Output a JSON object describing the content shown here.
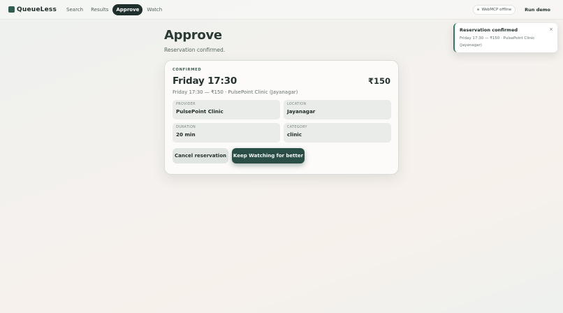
{
  "brand": {
    "name": "QueueLess"
  },
  "nav": {
    "items": [
      {
        "label": "Search",
        "active": false
      },
      {
        "label": "Results",
        "active": false
      },
      {
        "label": "Approve",
        "active": true
      },
      {
        "label": "Watch",
        "active": false
      }
    ]
  },
  "header": {
    "status_label": "WebMCP offline",
    "run_demo_label": "Run demo"
  },
  "page": {
    "title": "Approve",
    "subtitle": "Reservation confirmed."
  },
  "card": {
    "kicker": "CONFIRMED",
    "title": "Friday 17:30",
    "price": "₹150",
    "summary": "Friday 17:30 — ₹150 · PulsePoint Clinic (Jayanagar)",
    "fields": [
      {
        "label": "PROVIDER",
        "value": "PulsePoint Clinic"
      },
      {
        "label": "LOCATION",
        "value": "Jayanagar"
      },
      {
        "label": "DURATION",
        "value": "20 min"
      },
      {
        "label": "CATEGORY",
        "value": "clinic"
      }
    ],
    "cancel_label": "Cancel reservation",
    "keep_watching_label": "Keep Watching for better"
  },
  "toast": {
    "title": "Reservation confirmed",
    "body": "Friday 17:30 — ₹150 · PulsePoint Clinic (Jayanagar)",
    "close_glyph": "×"
  },
  "colors": {
    "accent": "#2a4d45",
    "nav_active_bg": "#1f2f2b",
    "toast_border": "#2f7b63"
  }
}
